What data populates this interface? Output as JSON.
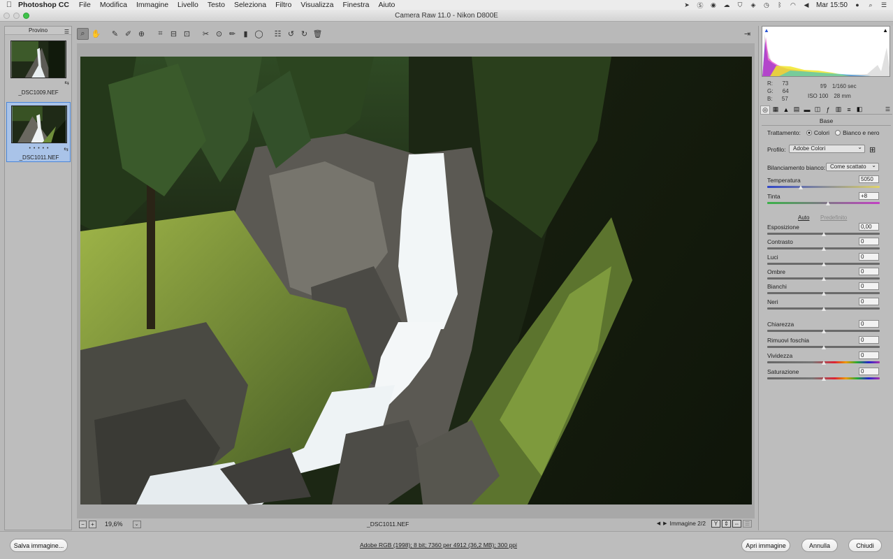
{
  "menubar": {
    "app_name": "Photoshop CC",
    "items": [
      "File",
      "Modifica",
      "Immagine",
      "Livello",
      "Testo",
      "Seleziona",
      "Filtro",
      "Visualizza",
      "Finestra",
      "Aiuto"
    ],
    "clock": "Mar 15:50"
  },
  "window": {
    "title": "Camera Raw 11.0  -  Nikon D800E"
  },
  "filmstrip": {
    "header": "Provino",
    "items": [
      {
        "name": "_DSC1009.NEF",
        "selected": false
      },
      {
        "name": "_DSC1011.NEF",
        "selected": true,
        "stars": "• • • • •"
      }
    ]
  },
  "toolbar": {
    "tools": [
      "zoom-icon",
      "hand-icon",
      "white-balance-icon",
      "color-sampler-icon",
      "target-adjust-icon",
      "crop-icon",
      "straighten-icon",
      "transform-icon",
      "spot-removal-icon",
      "red-eye-icon",
      "adjustment-brush-icon",
      "graduated-filter-icon",
      "radial-filter-icon",
      "preferences-icon",
      "rotate-left-icon",
      "rotate-right-icon",
      "trash-icon"
    ],
    "active": "zoom-icon"
  },
  "preview": {
    "zoom": "19,6%",
    "filename": "_DSC1011.NEF",
    "image_counter": "Immagine 2/2",
    "view_modes": [
      "Y",
      "⇕",
      "⇔"
    ]
  },
  "histogram": {
    "readout": {
      "r_label": "R:",
      "r": "73",
      "g_label": "G:",
      "g": "64",
      "b_label": "B:",
      "b": "57"
    },
    "camera": {
      "aperture": "f/9",
      "shutter": "1/160 sec",
      "iso": "ISO 100",
      "focal": "28 mm"
    }
  },
  "panel": {
    "title": "Base",
    "treatment_label": "Trattamento:",
    "treatment_options": [
      "Colori",
      "Bianco e nero"
    ],
    "treatment_selected": "Colori",
    "profile_label": "Profilo:",
    "profile_value": "Adobe Colori",
    "wb_label": "Bilanciamento bianco:",
    "wb_value": "Come scattato",
    "temperature": {
      "label": "Temperatura",
      "value": "5050",
      "position": 0.3
    },
    "tint": {
      "label": "Tinta",
      "value": "+8",
      "position": 0.54
    },
    "auto_label": "Auto",
    "default_label": "Predefinito",
    "sliders": [
      {
        "label": "Esposizione",
        "value": "0,00",
        "position": 0.5
      },
      {
        "label": "Contrasto",
        "value": "0",
        "position": 0.5
      },
      {
        "label": "Luci",
        "value": "0",
        "position": 0.5
      },
      {
        "label": "Ombre",
        "value": "0",
        "position": 0.5
      },
      {
        "label": "Bianchi",
        "value": "0",
        "position": 0.5
      },
      {
        "label": "Neri",
        "value": "0",
        "position": 0.5
      }
    ],
    "presence": [
      {
        "label": "Chiarezza",
        "value": "0",
        "position": 0.5
      },
      {
        "label": "Rimuovi foschia",
        "value": "0",
        "position": 0.5
      },
      {
        "label": "Vividezza",
        "value": "0",
        "position": 0.5
      },
      {
        "label": "Saturazione",
        "value": "0",
        "position": 0.5
      }
    ]
  },
  "footer": {
    "save_button": "Salva immagine...",
    "info": "Adobe RGB (1998); 8 bit; 7360 per 4912 (36,2 MB); 300 ppi",
    "open_button": "Apri immagine",
    "cancel_button": "Annulla",
    "close_button": "Chiudi"
  }
}
